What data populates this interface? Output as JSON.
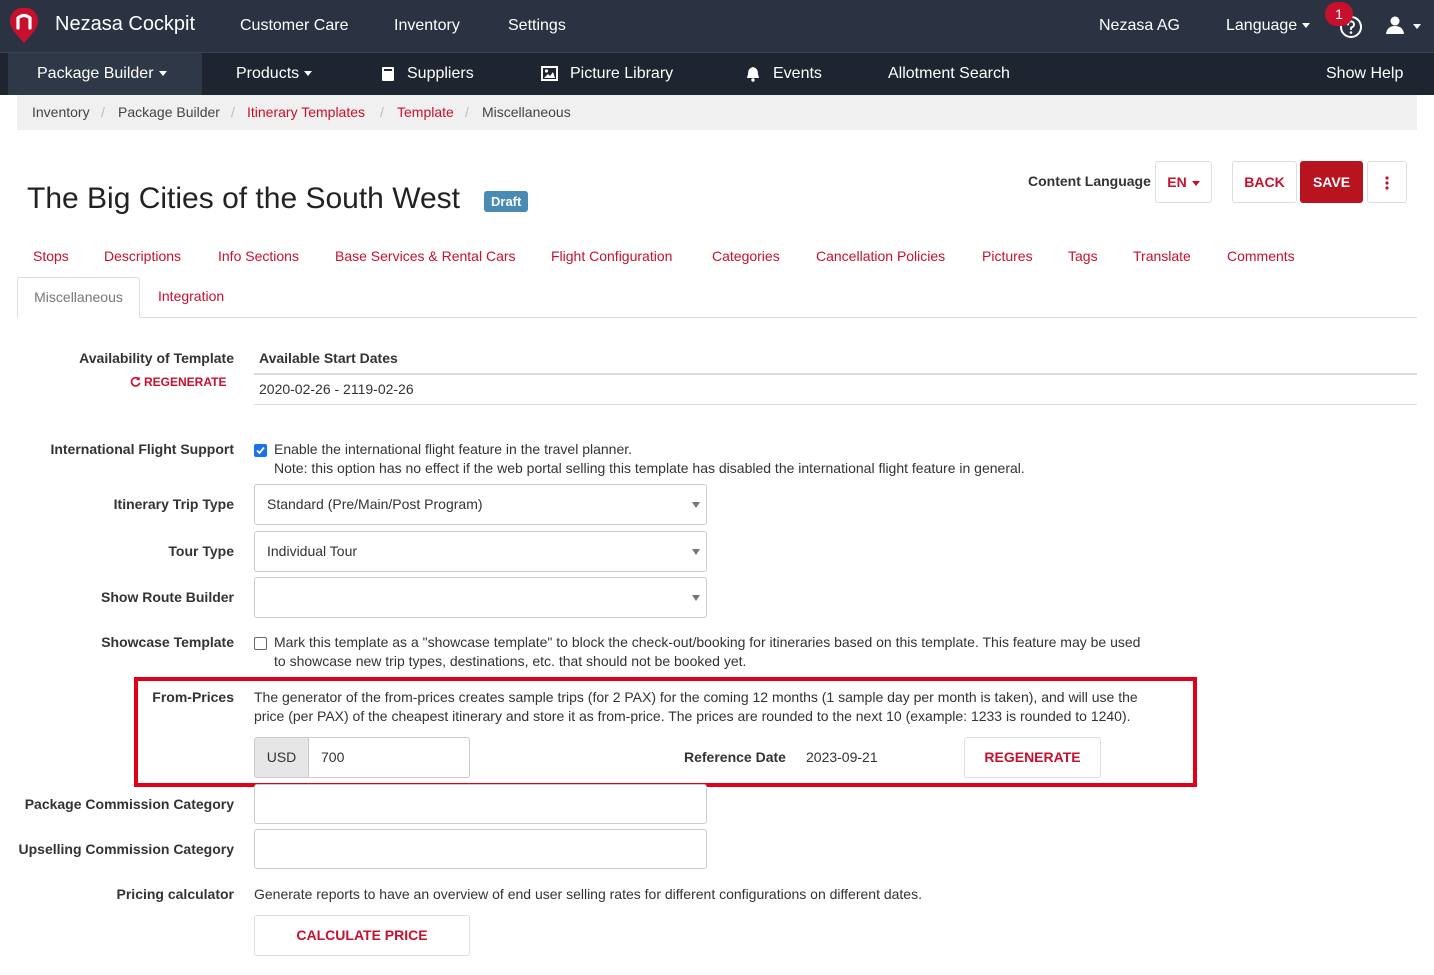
{
  "topbar": {
    "brand": "Nezasa Cockpit",
    "nav": [
      "Customer Care",
      "Inventory",
      "Settings"
    ],
    "company": "Nezasa AG",
    "language": "Language",
    "notifications": "1"
  },
  "subbar": {
    "package_builder": "Package Builder",
    "products": "Products",
    "suppliers": "Suppliers",
    "picture_library": "Picture Library",
    "events": "Events",
    "allotment_search": "Allotment Search",
    "show_help": "Show Help"
  },
  "breadcrumb": [
    "Inventory",
    "Package Builder",
    "Itinerary Templates",
    "Template",
    "Miscellaneous"
  ],
  "page": {
    "title": "The Big Cities of the South West",
    "status": "Draft",
    "content_language_label": "Content Language",
    "content_language": "EN",
    "back": "BACK",
    "save": "SAVE"
  },
  "tabs": [
    "Stops",
    "Descriptions",
    "Info Sections",
    "Base Services & Rental Cars",
    "Flight Configuration",
    "Categories",
    "Cancellation Policies",
    "Pictures",
    "Tags",
    "Translate",
    "Comments"
  ],
  "tabs_row2": {
    "active": "Miscellaneous",
    "integration": "Integration"
  },
  "form": {
    "availability": {
      "label": "Availability of Template",
      "regenerate": "REGENERATE",
      "column": "Available Start Dates",
      "value": "2020-02-26 - 2119-02-26"
    },
    "intl_flight": {
      "label": "International Flight Support",
      "checked": true,
      "text": "Enable the international flight feature in the travel planner.",
      "note": "Note: this option has no effect if the web portal selling this template has disabled the international flight feature in general."
    },
    "trip_type": {
      "label": "Itinerary Trip Type",
      "value": "Standard (Pre/Main/Post Program)"
    },
    "tour_type": {
      "label": "Tour Type",
      "value": "Individual Tour"
    },
    "route_builder": {
      "label": "Show Route Builder",
      "value": ""
    },
    "showcase": {
      "label": "Showcase Template",
      "checked": false,
      "line1": "Mark this template as a \"showcase template\" to block the check-out/booking for itineraries based on this template. This feature may be used",
      "line2": "to showcase new trip types, destinations, etc. that should not be booked yet."
    },
    "from_prices": {
      "label": "From-Prices",
      "line1": "The generator of the from-prices creates sample trips (for 2 PAX) for the coming 12 months (1 sample day per month is taken), and will use the",
      "line2": "price (per PAX) of the cheapest itinerary and store it as from-price. The prices are rounded to the next 10 (example: 1233 is rounded to 1240).",
      "currency": "USD",
      "amount": "700",
      "reference_date_label": "Reference Date",
      "reference_date": "2023-09-21",
      "regenerate": "REGENERATE"
    },
    "package_commission": {
      "label": "Package Commission Category"
    },
    "upselling_commission": {
      "label": "Upselling Commission Category"
    },
    "pricing_calculator": {
      "label": "Pricing calculator",
      "text": "Generate reports to have an overview of end user selling rates for different configurations on different dates.",
      "button": "CALCULATE PRICE"
    }
  },
  "colors": {
    "navbar": "#2b3342",
    "subnav": "#1e2530",
    "accent": "#c8102e",
    "highlight": "#e0001a"
  }
}
